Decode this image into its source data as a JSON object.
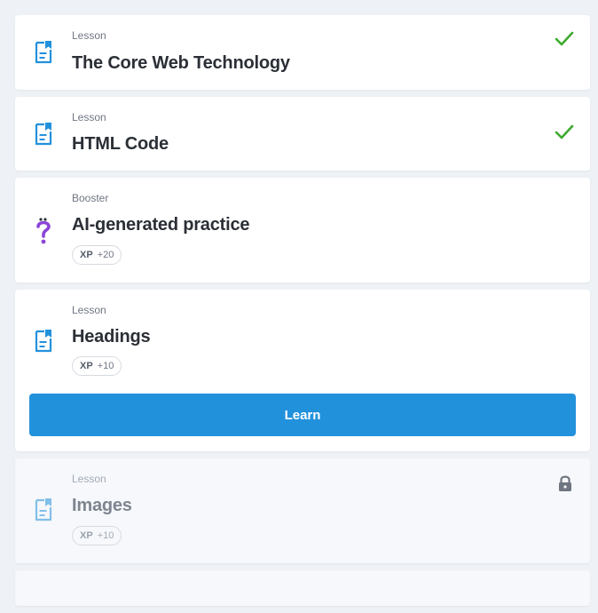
{
  "lessons": [
    {
      "category": "Lesson",
      "title": "The Core Web Technology",
      "icon": "lesson-doc-icon",
      "status": "completed"
    },
    {
      "category": "Lesson",
      "title": "HTML Code",
      "icon": "lesson-doc-icon",
      "status": "completed"
    },
    {
      "category": "Booster",
      "title": "AI-generated practice",
      "icon": "question-mark-icon",
      "xp_label": "XP",
      "xp_value": "+20",
      "status": "available"
    },
    {
      "category": "Lesson",
      "title": "Headings",
      "icon": "lesson-doc-icon",
      "xp_label": "XP",
      "xp_value": "+10",
      "status": "current",
      "button_label": "Learn"
    },
    {
      "category": "Lesson",
      "title": "Images",
      "icon": "lesson-doc-icon",
      "xp_label": "XP",
      "xp_value": "+10",
      "status": "locked"
    }
  ],
  "colors": {
    "accent": "#2291dc",
    "check": "#3daa2e",
    "booster": "#8b45d6",
    "lock": "#6e7580"
  }
}
